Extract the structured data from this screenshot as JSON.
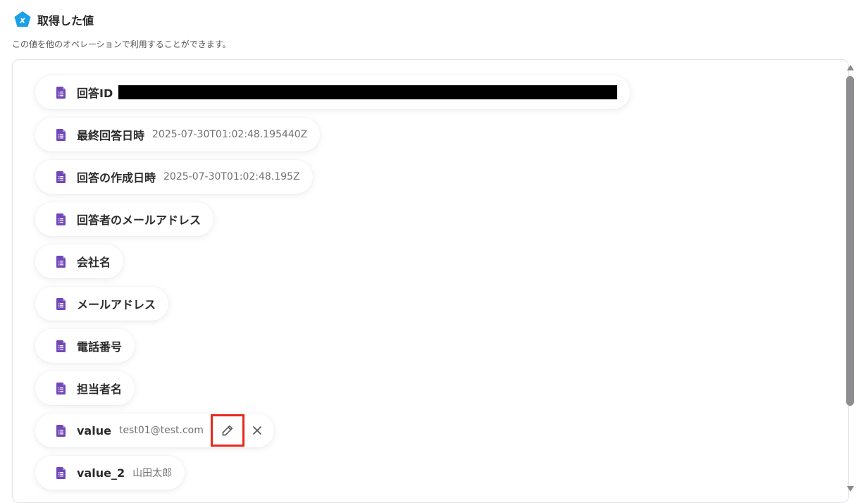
{
  "header": {
    "title": "取得した値",
    "subtitle": "この値を他のオペレーションで利用することができます。",
    "logo_icon": "yoom-logo-icon"
  },
  "colors": {
    "logo": "#1aa0e6",
    "doc_icon": "#7248b9",
    "highlight": "#e8281c",
    "scroll_thumb": "#8e8e92"
  },
  "items": [
    {
      "label": "回答ID",
      "value": ""
    },
    {
      "label": "最終回答日時",
      "value": "2025-07-30T01:02:48.195440Z"
    },
    {
      "label": "回答の作成日時",
      "value": "2025-07-30T01:02:48.195Z"
    },
    {
      "label": "回答者のメールアドレス",
      "value": ""
    },
    {
      "label": "会社名",
      "value": ""
    },
    {
      "label": "メールアドレス",
      "value": ""
    },
    {
      "label": "電話番号",
      "value": ""
    },
    {
      "label": "担当者名",
      "value": ""
    },
    {
      "label": "value",
      "value": "test01@test.com"
    },
    {
      "label": "value_2",
      "value": "山田太郎"
    }
  ],
  "icons": {
    "item": "google-forms-doc-icon",
    "edit": "pencil-icon",
    "remove": "close-icon"
  }
}
